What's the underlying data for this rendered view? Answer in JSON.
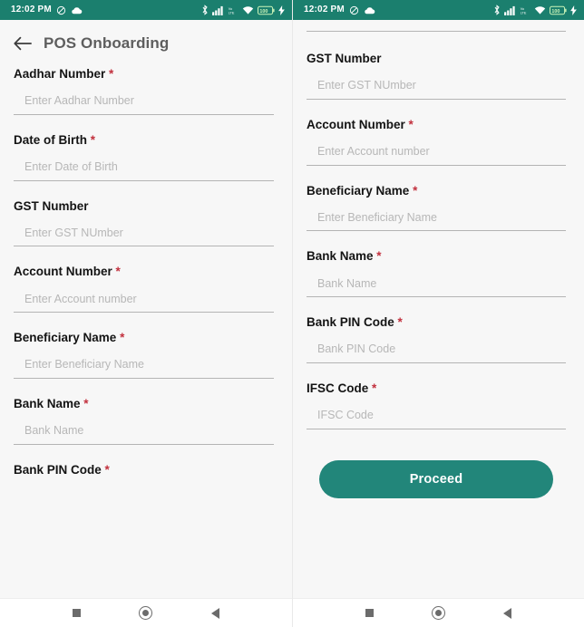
{
  "status_bar": {
    "time": "12:02 PM",
    "icons_left": [
      "dnd-icon",
      "weather-cloud-icon"
    ],
    "icons_right": [
      "bluetooth-icon",
      "signal-bars-icon",
      "volte-icon",
      "wifi-icon",
      "battery-icon",
      "charging-bolt-icon"
    ],
    "battery_level": "100",
    "background_color": "#1b7f6e"
  },
  "app_bar": {
    "back_icon": "back-arrow-icon",
    "title": "POS Onboarding"
  },
  "theme": {
    "accent": "#1b7f6e",
    "button": "#22867a",
    "required_mark": "#c2303d",
    "page_bg": "#f7f7f7",
    "underline": "#b4b4b4",
    "placeholder": "#b7b7b7"
  },
  "required_mark": "*",
  "screens": [
    {
      "name": "pos-onboarding-top",
      "scrolled": false,
      "fields": [
        {
          "label": "Aadhar Number",
          "required": true,
          "placeholder": "Enter Aadhar Number",
          "value": ""
        },
        {
          "label": "Date of Birth",
          "required": true,
          "placeholder": "Enter Date of Birth",
          "value": ""
        },
        {
          "label": "GST Number",
          "required": false,
          "placeholder": "Enter GST NUmber",
          "value": ""
        },
        {
          "label": "Account Number",
          "required": true,
          "placeholder": "Enter Account number",
          "value": ""
        },
        {
          "label": "Beneficiary Name",
          "required": true,
          "placeholder": "Enter Beneficiary Name",
          "value": ""
        },
        {
          "label": "Bank Name",
          "required": true,
          "placeholder": "Bank Name",
          "value": ""
        },
        {
          "label": "Bank PIN Code",
          "required": true,
          "placeholder": "",
          "value": "",
          "clipped": true
        }
      ],
      "show_proceed": false
    },
    {
      "name": "pos-onboarding-bottom",
      "scrolled": true,
      "fields": [
        {
          "label": "GST Number",
          "required": false,
          "placeholder": "Enter GST NUmber",
          "value": ""
        },
        {
          "label": "Account Number",
          "required": true,
          "placeholder": "Enter Account number",
          "value": ""
        },
        {
          "label": "Beneficiary Name",
          "required": true,
          "placeholder": "Enter Beneficiary Name",
          "value": ""
        },
        {
          "label": "Bank Name",
          "required": true,
          "placeholder": "Bank Name",
          "value": ""
        },
        {
          "label": "Bank PIN Code",
          "required": true,
          "placeholder": "Bank PIN Code",
          "value": ""
        },
        {
          "label": "IFSC Code",
          "required": true,
          "placeholder": "IFSC Code",
          "value": ""
        }
      ],
      "show_proceed": true,
      "proceed_label": "Proceed"
    }
  ],
  "nav_bar": {
    "buttons": [
      {
        "name": "recents-button",
        "icon": "square-icon"
      },
      {
        "name": "home-button",
        "icon": "circle-icon"
      },
      {
        "name": "back-button",
        "icon": "triangle-left-icon"
      }
    ]
  }
}
